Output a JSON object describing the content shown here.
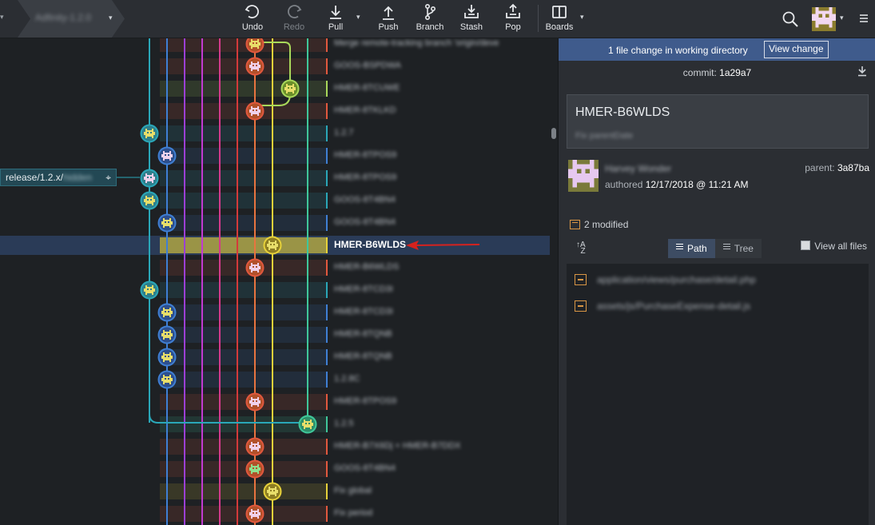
{
  "repo_tab": {
    "name": "Adfinity-1.2.0"
  },
  "toolbar": {
    "buttons": [
      {
        "label": "Undo",
        "icon": "undo-icon",
        "disabled": false
      },
      {
        "label": "Redo",
        "icon": "redo-icon",
        "disabled": true
      },
      {
        "label": "Pull",
        "icon": "pull-icon",
        "disabled": false
      },
      {
        "label": "Push",
        "icon": "push-icon",
        "disabled": false
      },
      {
        "label": "Branch",
        "icon": "branch-icon",
        "disabled": false
      },
      {
        "label": "Stash",
        "icon": "stash-icon",
        "disabled": false
      },
      {
        "label": "Pop",
        "icon": "pop-icon",
        "disabled": false
      },
      {
        "label": "Boards",
        "icon": "boards-icon",
        "disabled": false
      }
    ]
  },
  "graph": {
    "branch_label": {
      "prefix": "release/1.2.x/",
      "hidden": "hidden"
    },
    "selected_message": "HMER-B6WLDS",
    "rows": [
      {
        "msg": "Merge remote-tracking branch 'origin/deve",
        "lane_color": "#e2583e"
      },
      {
        "msg": "GOOS-BSPDWA",
        "lane_color": "#e2583e"
      },
      {
        "msg": "HMER-8TCUWE",
        "lane_color": "#a8d85a"
      },
      {
        "msg": "HMER-8TKLKD",
        "lane_color": "#e2583e"
      },
      {
        "msg": "1.2.7",
        "lane_color": "#2aa7b8"
      },
      {
        "msg": "HMER-8TPOS9",
        "lane_color": "#3f7fd4"
      },
      {
        "msg": "HMER-8TPOS9",
        "lane_color": "#2aa7b8"
      },
      {
        "msg": "GOOS-8T4BN4",
        "lane_color": "#2aa7b8"
      },
      {
        "msg": "GOOS-8T4BN4",
        "lane_color": "#3f7fd4"
      },
      {
        "msg": "HMER-B6WLDS",
        "lane_color": "#e6d13a"
      },
      {
        "msg": "HMER-B6WLDS",
        "lane_color": "#e2583e"
      },
      {
        "msg": "HMER-8TCD3I",
        "lane_color": "#2aa7b8"
      },
      {
        "msg": "HMER-8TCD3I",
        "lane_color": "#3f7fd4"
      },
      {
        "msg": "HMER-8TQNB",
        "lane_color": "#3f7fd4"
      },
      {
        "msg": "HMER-8TQNB",
        "lane_color": "#3f7fd4"
      },
      {
        "msg": "1.2.8C",
        "lane_color": "#3f7fd4"
      },
      {
        "msg": "HMER-8TPOS9",
        "lane_color": "#e2583e"
      },
      {
        "msg": "1.2.5",
        "lane_color": "#3fc79a"
      },
      {
        "msg": "HMER-B7X6Dj + HMER-B7DDX",
        "lane_color": "#e2583e"
      },
      {
        "msg": "GOOS-8T4BN4",
        "lane_color": "#e2583e"
      },
      {
        "msg": "Fix global",
        "lane_color": "#e6d13a"
      },
      {
        "msg": "Fix period",
        "lane_color": "#e2583e"
      }
    ]
  },
  "panel": {
    "wip_text": "1 file change in working directory",
    "view_change": "View change",
    "commit_label": "commit:",
    "commit_sha": "1a29a7",
    "summary_title": "HMER-B6WLDS",
    "summary_desc": "Fix parentDate",
    "author_name": "Harvey Wonder",
    "parent_label": "parent:",
    "parent_sha": "3a87ba",
    "authored_label": "authored",
    "authored_date": "12/17/2018 @ 11:21 AM",
    "modified_text": "2 modified",
    "path_label": "Path",
    "tree_label": "Tree",
    "view_all_label": "View all files",
    "files": [
      "application/views/purchase/detail.php",
      "assets/js/PurchaseExpense-detail.js"
    ]
  }
}
